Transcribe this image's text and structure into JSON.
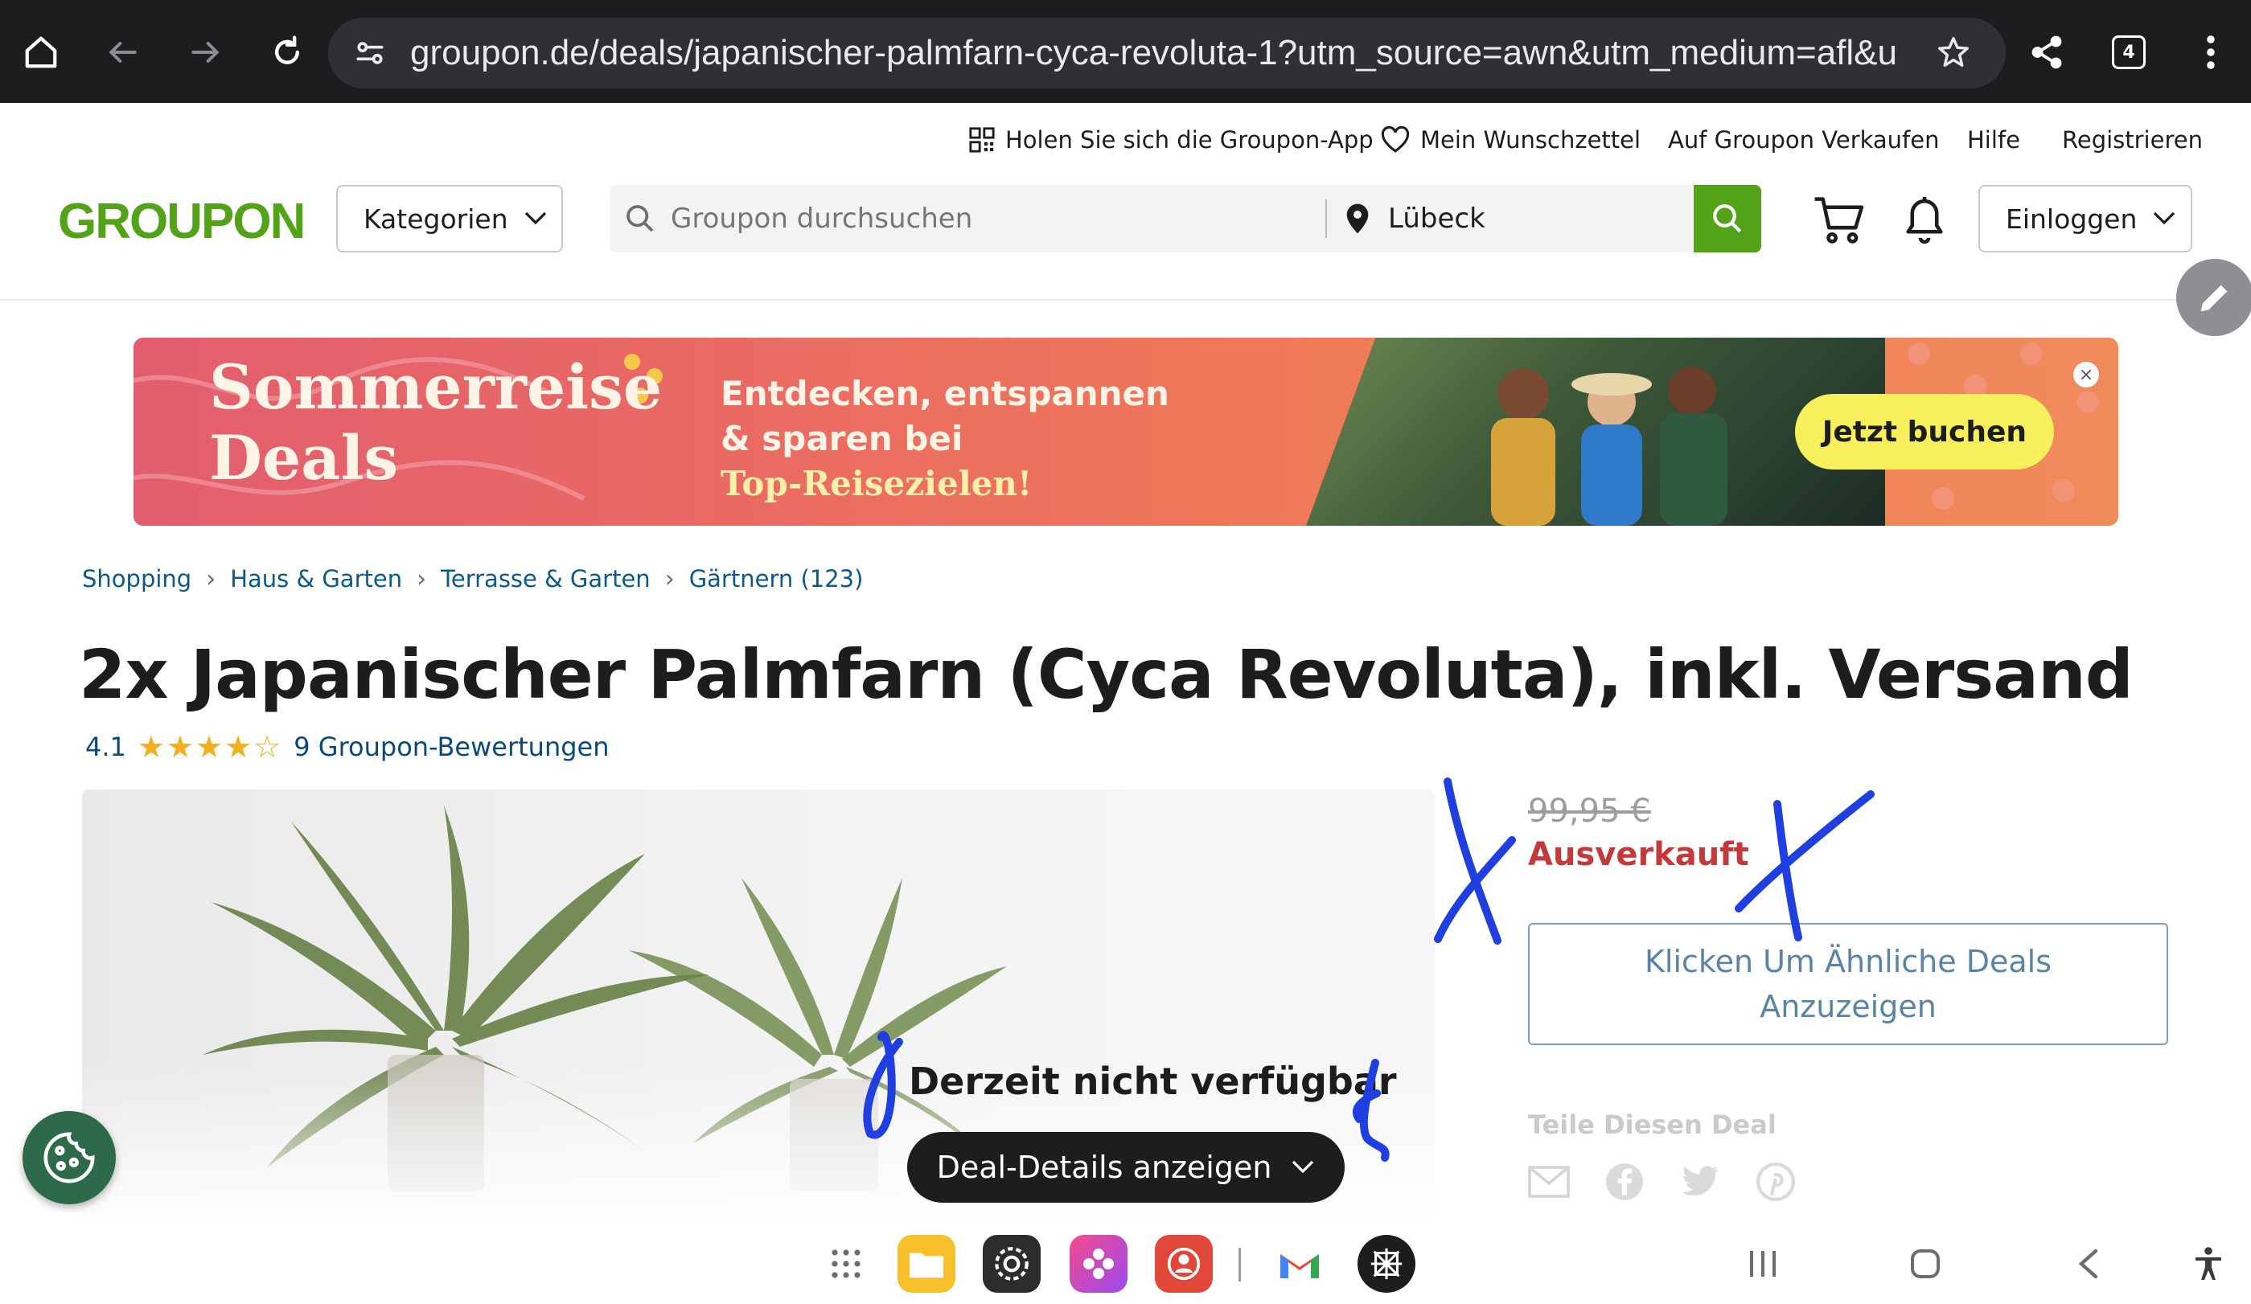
{
  "browser": {
    "url": "groupon.de/deals/japanischer-palmfarn-cyca-revoluta-1?utm_source=awn&utm_medium=afl&u",
    "tab_count": "4"
  },
  "top_links": {
    "app": "Holen Sie sich die Groupon-App",
    "wishlist": "Mein Wunschzettel",
    "sell": "Auf Groupon Verkaufen",
    "help": "Hilfe",
    "register": "Registrieren"
  },
  "header": {
    "logo": "GROUPON",
    "categories_label": "Kategorien",
    "search_placeholder": "Groupon durchsuchen",
    "location": "Lübeck",
    "login_label": "Einloggen"
  },
  "banner": {
    "title_line1": "Sommerreise",
    "title_line2": "Deals",
    "sub_line1": "Entdecken, entspannen",
    "sub_line2": "& sparen bei",
    "sub_line3": "Top-Reisezielen!",
    "cta": "Jetzt buchen",
    "close": "×"
  },
  "breadcrumb": [
    "Shopping",
    "Haus & Garten",
    "Terrasse & Garten",
    "Gärtnern (123)"
  ],
  "product": {
    "title": "2x Japanischer Palmfarn (Cyca Revoluta), inkl. Versand",
    "rating_value": "4.1",
    "rating_stars": 4.1,
    "reviews_label": "9 Groupon-Bewertungen",
    "unavailable_label": "Derzeit nicht verfügbar",
    "details_button": "Deal-Details anzeigen",
    "old_price": "99,95 €",
    "status": "Ausverkauft",
    "similar_button_line1": "Klicken Um Ähnliche Deals",
    "similar_button_line2": "Anzuzeigen",
    "share_label": "Teile Diesen Deal"
  },
  "colors": {
    "brand_green": "#53a318",
    "sold_out_red": "#c43a3a",
    "link_blue": "#0a5a8a",
    "annotation_blue": "#1f3fe0"
  },
  "icons": {
    "browser": [
      "home-icon",
      "back-icon",
      "forward-icon",
      "reload-icon",
      "site-settings-icon",
      "bookmark-star-icon",
      "share-icon",
      "tabs-icon",
      "menu-icon"
    ],
    "header": [
      "qr-code-icon",
      "heart-icon",
      "search-icon",
      "location-pin-icon",
      "cart-icon",
      "bell-icon",
      "chevron-down-icon"
    ],
    "share": [
      "email-icon",
      "facebook-icon",
      "twitter-icon",
      "pinterest-icon"
    ]
  }
}
